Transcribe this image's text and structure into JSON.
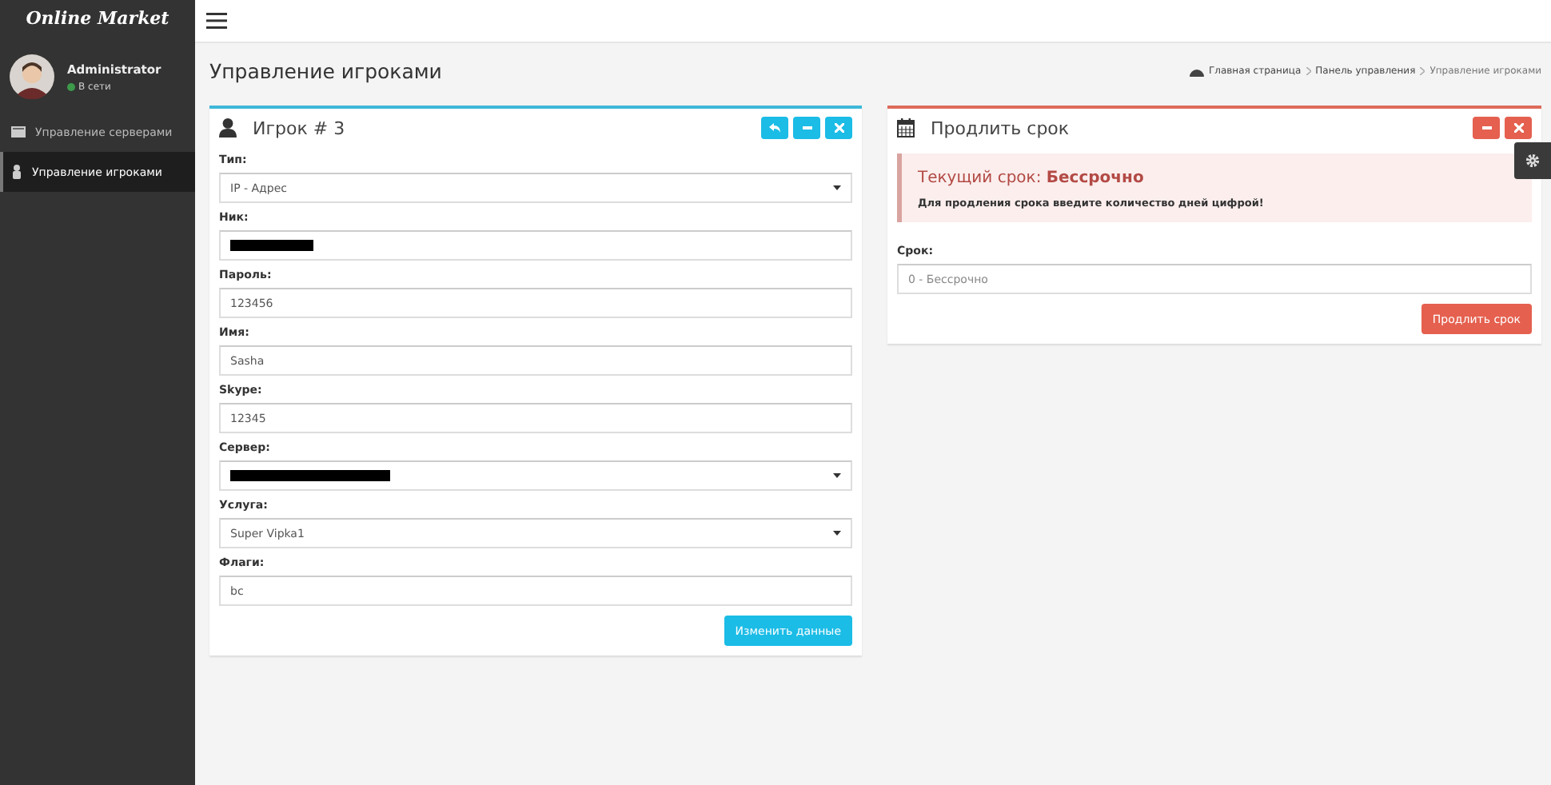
{
  "brand": "Online Market",
  "user": {
    "name": "Administrator",
    "status": "В сети"
  },
  "sidebar": {
    "items": [
      {
        "label": "Управление серверами",
        "selected": false
      },
      {
        "label": "Управление игроками",
        "selected": true
      }
    ]
  },
  "page": {
    "title": "Управление игроками"
  },
  "breadcrumbs": [
    "Главная страница",
    "Панель управления",
    "Управление игроками"
  ],
  "player_card": {
    "title": "Игрок # 3",
    "fields": [
      {
        "label": "Тип:",
        "kind": "select",
        "value": "IP - Адрес",
        "redacted": false
      },
      {
        "label": "Ник:",
        "kind": "input",
        "redacted": true
      },
      {
        "label": "Пароль:",
        "kind": "input",
        "value": "123456",
        "redacted": false
      },
      {
        "label": "Имя:",
        "kind": "input",
        "value": "Sasha",
        "redacted": false
      },
      {
        "label": "Skype:",
        "kind": "input",
        "value": "12345",
        "redacted": false
      },
      {
        "label": "Сервер:",
        "kind": "select",
        "redacted": true
      },
      {
        "label": "Услуга:",
        "kind": "select",
        "value": "Super Vipka1",
        "redacted": false
      },
      {
        "label": "Флаги:",
        "kind": "input",
        "value": "bc",
        "redacted": false
      }
    ],
    "submit": "Изменить данные"
  },
  "extend_card": {
    "title": "Продлить срок",
    "alert_title": "Текущий срок: **Бессрочно**",
    "alert_text": "Для продления срока введите количество дней цифрой!",
    "field_label": "Срок:",
    "placeholder": "0 - Бессрочно",
    "submit": "Продлить срок"
  }
}
